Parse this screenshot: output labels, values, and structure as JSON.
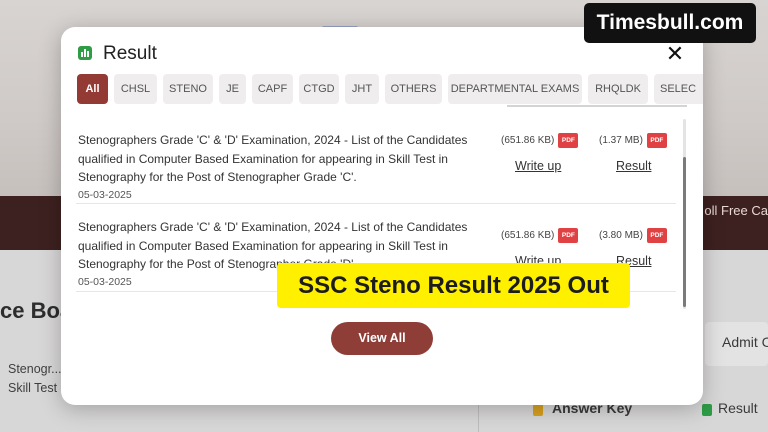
{
  "watermark": "Timesbull.com",
  "background": {
    "band_text": "oll Free Ca",
    "left_title": "ce Boa",
    "left_text": "Stenogr... Result of ... appearing in Skill Test in Stenography.",
    "admit_label": "Admit C",
    "answer_key_label": "Answer Key",
    "result_label": "Result"
  },
  "modal": {
    "title": "Result",
    "icon": "chart-bar-icon",
    "close_icon": "close-icon",
    "tabs": [
      {
        "label": "All",
        "active": true
      },
      {
        "label": "CHSL",
        "active": false
      },
      {
        "label": "STENO",
        "active": false
      },
      {
        "label": "JE",
        "active": false
      },
      {
        "label": "CAPF",
        "active": false
      },
      {
        "label": "CTGD",
        "active": false
      },
      {
        "label": "JHT",
        "active": false
      },
      {
        "label": "OTHERS",
        "active": false
      },
      {
        "label": "DEPARTMENTAL EXAMS",
        "active": false
      },
      {
        "label": "RHQLDK",
        "active": false
      },
      {
        "label": "SELEC",
        "active": false
      }
    ],
    "rows": [
      {
        "title": "Stenographers Grade 'C' & 'D' Examination, 2024 - List of the Candidates qualified in Computer Based Examination for appearing in Skill Test in Stenography for the Post of Stenographer Grade 'C'.",
        "date": "05-03-2025",
        "file1_size": "(651.86 KB)",
        "file1_label": "Write up",
        "file2_size": "(1.37 MB)",
        "file2_label": "Result"
      },
      {
        "title": "Stenographers Grade 'C' & 'D' Examination, 2024 - List of the Candidates qualified in Computer Based Examination for appearing in Skill Test in Stenography for the Post of Stenographer Grade 'D'.",
        "date": "05-03-2025",
        "file1_size": "(651.86 KB)",
        "file1_label": "Write up",
        "file2_size": "(3.80 MB)",
        "file2_label": "Result"
      }
    ],
    "pdf_badge": "PDF",
    "view_all_label": "View All"
  },
  "banner_text": "SSC Steno Result 2025 Out",
  "colors": {
    "accent": "#933a35",
    "pdf_red": "#e04244",
    "banner_yellow": "#fff000",
    "result_icon_green": "#2e9d46"
  }
}
